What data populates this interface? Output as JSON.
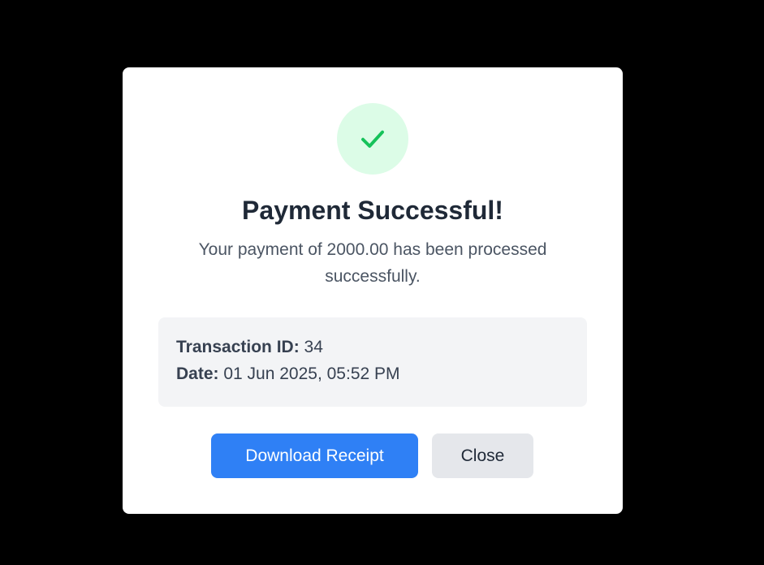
{
  "modal": {
    "icon": "check-icon",
    "title": "Payment Successful!",
    "message": "Your payment of 2000.00 has been processed successfully.",
    "details": {
      "transaction_label": "Transaction ID:",
      "transaction_value": "34",
      "date_label": "Date:",
      "date_value": "01 Jun 2025, 05:52 PM"
    },
    "buttons": {
      "download_label": "Download Receipt",
      "close_label": "Close"
    }
  },
  "colors": {
    "overlay": "#000000",
    "success_bg": "#dcfce7",
    "success_check": "#16c25a",
    "primary": "#2f80f5",
    "secondary": "#e5e7eb"
  }
}
